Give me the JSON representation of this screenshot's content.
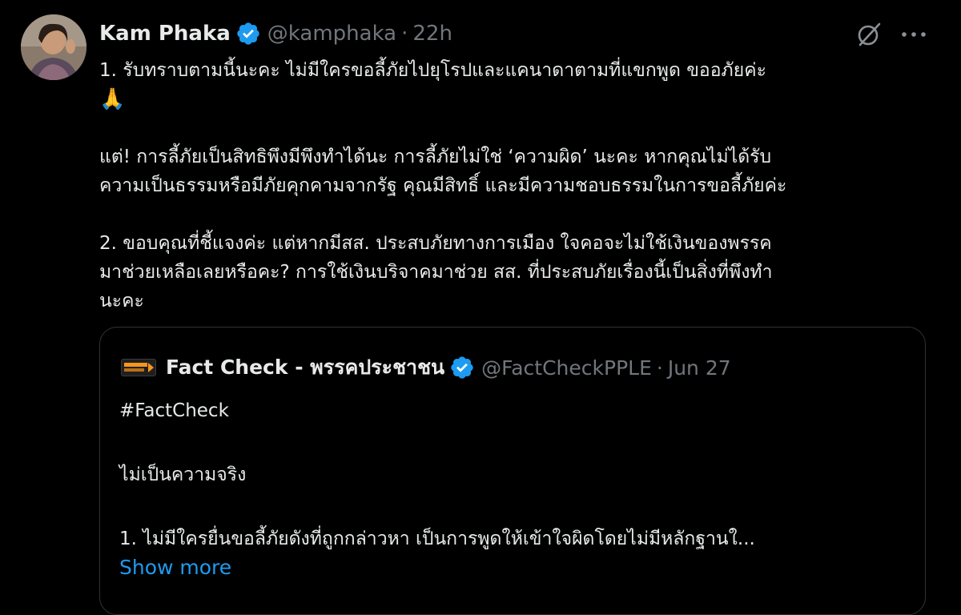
{
  "tweet": {
    "author_name": "Kam Phaka",
    "handle": "@kamphaka",
    "separator": "·",
    "time": "22h",
    "text_lines": [
      "1. รับทราบตามนี้นะคะ ไม่มีใครขอลี้ภัยไปยุโรปและแคนาดาตามที่แขกพูด ขออภัยค่ะ",
      "🙏",
      " แต่! การลี้ภัยเป็นสิทธิพึงมีพึงทำได้นะ การลี้ภัยไม่ใช่ ‘ความผิด’ นะคะ หากคุณไม่ได้รับ",
      "ความเป็นธรรมหรือมีภัยคุกคามจากรัฐ คุณมีสิทธิ์ และมีความชอบธรรมในการขอลี้ภัยค่ะ",
      "2. ขอบคุณที่ชี้แจงค่ะ แต่หากมีสส. ประสบภัยทางการเมือง ใจคอจะไม่ใช้เงินของพรรค",
      "มาช่วยเหลือเลยหรือคะ? การใช้เงินบริจาคมาช่วย สส. ที่ประสบภัยเรื่องนี้เป็นสิ่งที่พึงทำ",
      "นะคะ"
    ],
    "icons": {
      "verified": "verified-badge-icon",
      "grok": "grok-icon",
      "more": "more-options-icon"
    },
    "accent_color": "#1d9bf0"
  },
  "quote": {
    "author_name": "Fact Check - พรรคประชาชน",
    "handle": "@FactCheckPPLE",
    "separator": "·",
    "date": "Jun 27",
    "lines": [
      "#FactCheck",
      "ไม่เป็นความจริง",
      "1. ไม่มีใครยื่นขอลี้ภัยดังที่ถูกกล่าวหา เป็นการพูดให้เข้าใจผิดโดยไม่มีหลักฐานใ..."
    ],
    "show_more": "Show more",
    "logo_color": "#f7941d"
  }
}
